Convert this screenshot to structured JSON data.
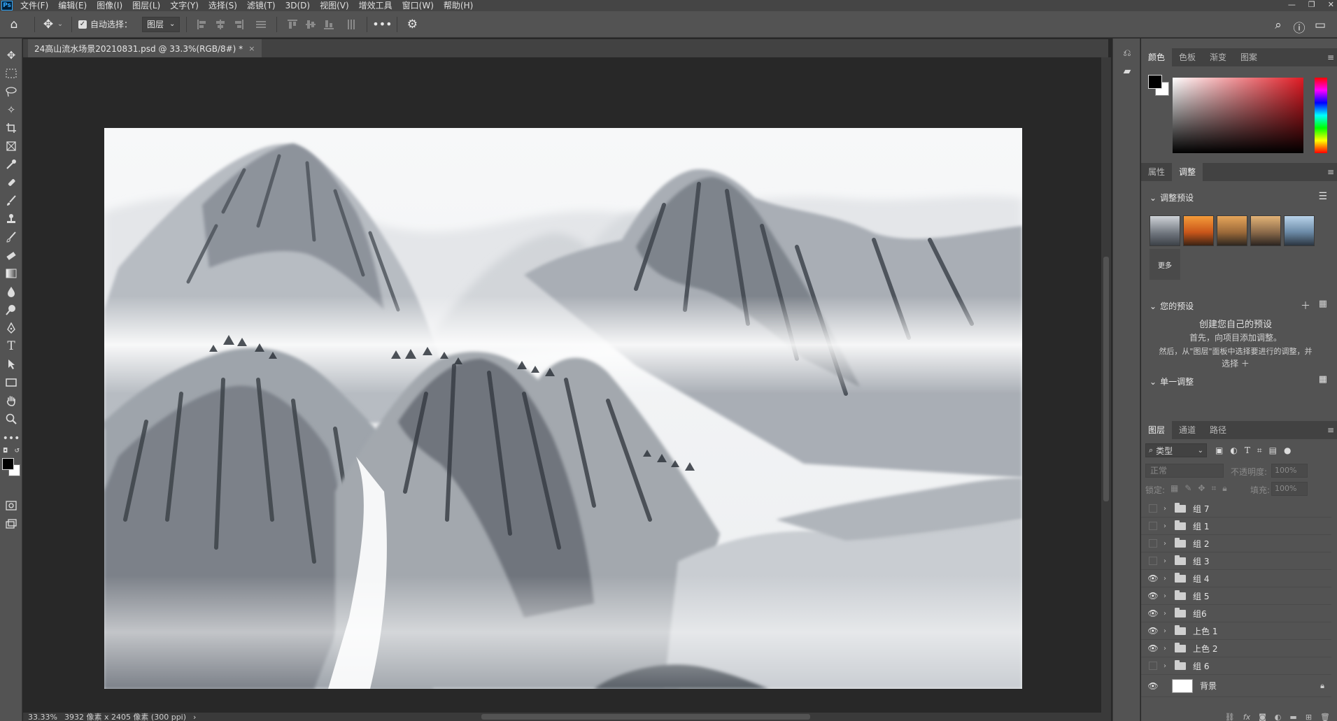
{
  "menu": {
    "logo": "Ps",
    "items": [
      "文件(F)",
      "编辑(E)",
      "图像(I)",
      "图层(L)",
      "文字(Y)",
      "选择(S)",
      "滤镜(T)",
      "3D(D)",
      "视图(V)",
      "增效工具",
      "窗口(W)",
      "帮助(H)"
    ]
  },
  "options": {
    "auto_select_label": "自动选择：",
    "auto_select_checked": true,
    "auto_select_target": "图层"
  },
  "document": {
    "tab_title": "24高山流水场景20210831.psd @ 33.3%(RGB/8#) *",
    "close_glyph": "×"
  },
  "status": {
    "zoom": "33.33%",
    "doc_info": "3932 像素 x 2405 像素 (300 ppi)"
  },
  "color_panel": {
    "tabs": [
      "颜色",
      "色板",
      "渐变",
      "图案"
    ],
    "active_tab": "颜色",
    "foreground": "#000000",
    "background": "#ffffff"
  },
  "adjustments_panel": {
    "tabs": [
      "属性",
      "调整"
    ],
    "active_tab": "调整",
    "presets_header": "调整预设",
    "more_label": "更多",
    "your_presets_header": "您的预设",
    "create_title": "创建您自己的预设",
    "create_line1": "首先，向项目添加调整。",
    "create_line2": "然后，从\"图层\"面板中选择要进行的调整，并",
    "create_line3": "选择 ＋",
    "single_adjust_header": "单一调整"
  },
  "layers_panel": {
    "tabs": [
      "图层",
      "通道",
      "路径"
    ],
    "active_tab": "图层",
    "filter_label": "类型",
    "blend_mode": "正常",
    "opacity_label": "不透明度:",
    "opacity_value": "100%",
    "lock_label": "锁定:",
    "fill_label": "填充:",
    "fill_value": "100%",
    "layers": [
      {
        "name": "组 7",
        "visible": false
      },
      {
        "name": "组 1",
        "visible": false
      },
      {
        "name": "组 2",
        "visible": false
      },
      {
        "name": "组 3",
        "visible": false
      },
      {
        "name": "组 4",
        "visible": true
      },
      {
        "name": "组 5",
        "visible": true
      },
      {
        "name": "组6",
        "visible": true
      },
      {
        "name": "上色 1",
        "visible": true
      },
      {
        "name": "上色 2",
        "visible": true
      },
      {
        "name": "组 6",
        "visible": false
      }
    ],
    "background_layer": {
      "name": "背景",
      "visible": true,
      "locked": true
    }
  }
}
